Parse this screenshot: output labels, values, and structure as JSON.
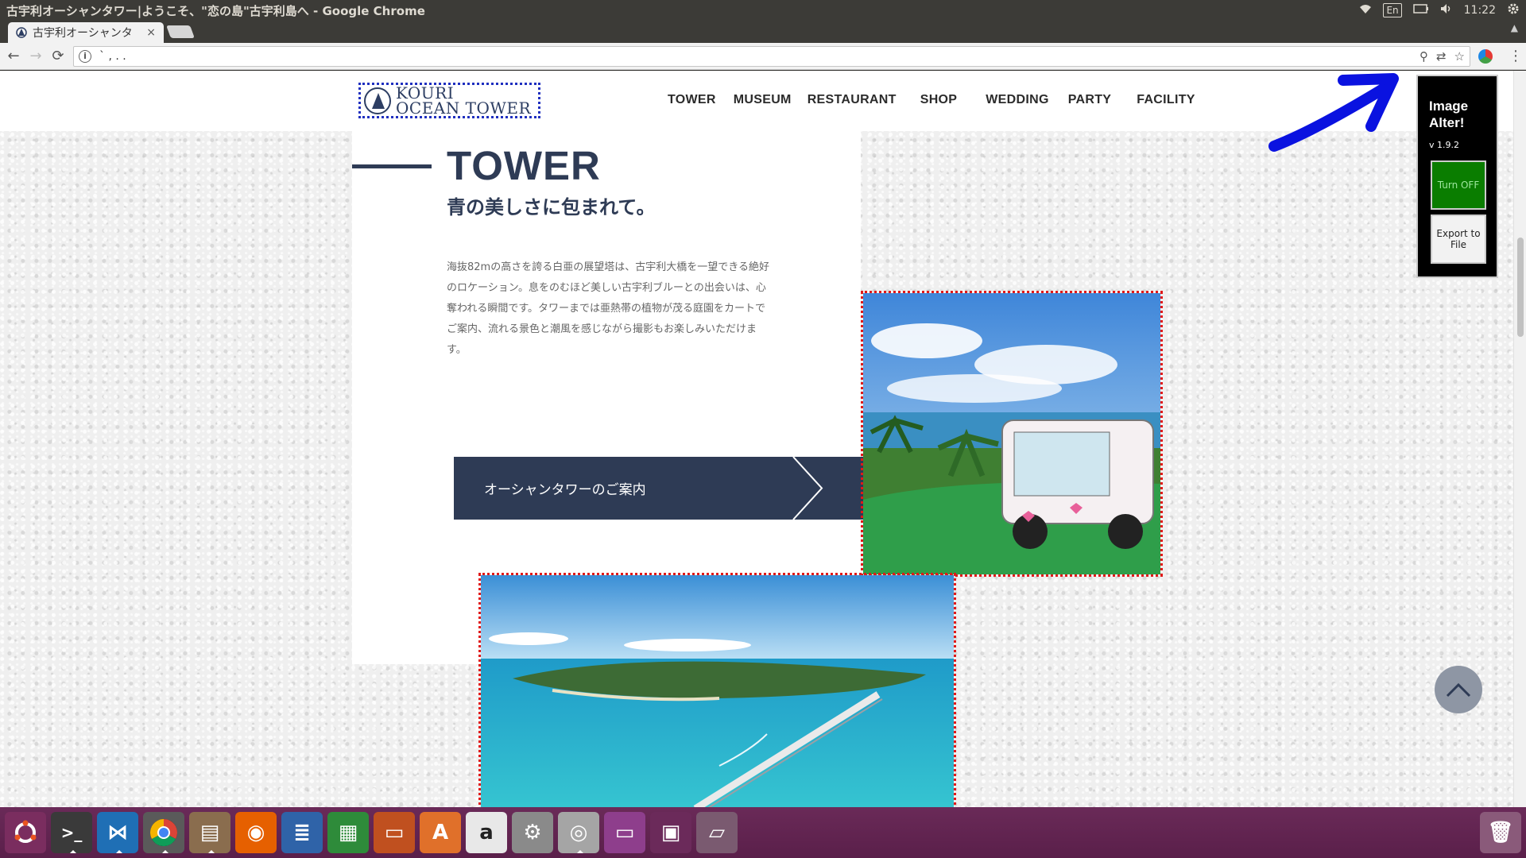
{
  "os": {
    "window_title": "古宇利オーシャンタワー|ようこそ、\"恋の島\"古宇利島へ - Google Chrome",
    "keyboard": "En",
    "clock": "11:22"
  },
  "browser": {
    "tab_title": "古宇利オーシャンタ",
    "tab_close": "×",
    "url": "` , . .",
    "back": "←",
    "forward": "→",
    "reload": "⟳",
    "info": "i",
    "menu": "⋮"
  },
  "site": {
    "logo_line1": "KOURI",
    "logo_line2": "OCEAN TOWER",
    "nav": [
      "TOWER",
      "MUSEUM",
      "RESTAURANT",
      "SHOP",
      "WEDDING",
      "PARTY",
      "FACILITY"
    ],
    "section_title": "TOWER",
    "section_subtitle": "青の美しさに包まれて。",
    "section_text": "海抜82mの高さを誇る白亜の展望塔は、古宇利大橋を一望できる絶好のロケーション。息をのむほど美しい古宇利ブルーとの出会いは、心奪われる瞬間です。タワーまでは亜熱帯の植物が茂る庭園をカートでご案内、流れる景色と潮風を感じながら撮影もお楽しみいただけます。",
    "guide_button": "オーシャンタワーのご案内"
  },
  "extension": {
    "title_line1": "Image",
    "title_line2": "Alter!",
    "version": "v 1.9.2",
    "toggle_label": "Turn OFF",
    "export_label": "Export to File"
  },
  "dock": {
    "items": [
      "ubuntu-icon",
      "terminal-icon",
      "vscode-icon",
      "chrome-icon",
      "files-icon",
      "firefox-icon",
      "writer-icon",
      "calc-icon",
      "impress-icon",
      "software-center-icon",
      "amazon-icon",
      "settings-icon",
      "screenshot-icon",
      "window-icon",
      "workspace-icon",
      "drive-icon",
      "trash-icon"
    ]
  }
}
